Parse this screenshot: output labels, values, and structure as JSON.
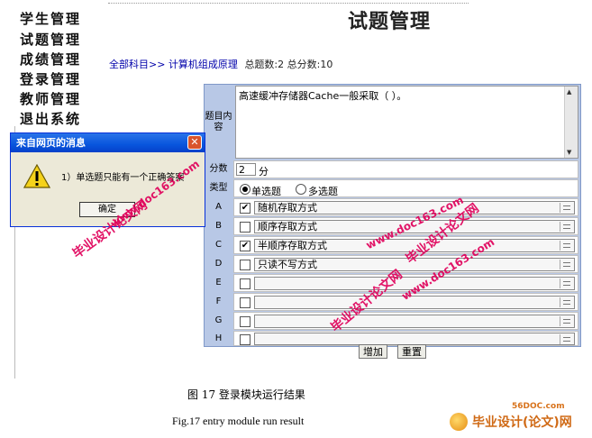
{
  "nav": {
    "items": [
      "学生管理",
      "试题管理",
      "成绩管理",
      "登录管理",
      "教师管理",
      "退出系统"
    ]
  },
  "page_title": "试题管理",
  "breadcrumb": {
    "root": "全部科目",
    "separator": ">>",
    "subject": "计算机组成原理",
    "info": "总题数:2 总分数:10"
  },
  "form": {
    "content_label": "题目内容",
    "content_value": "高速缓冲存储器Cache一般采取（ ）。",
    "score_label": "分数",
    "score_value": "2",
    "score_unit": "分",
    "type_label": "类型",
    "type_single": "单选题",
    "type_multi": "多选题",
    "type_selected": "single",
    "options": [
      {
        "key": "A",
        "text": "随机存取方式",
        "checked": true
      },
      {
        "key": "B",
        "text": "顺序存取方式",
        "checked": false
      },
      {
        "key": "C",
        "text": "半顺序存取方式",
        "checked": true
      },
      {
        "key": "D",
        "text": "只读不写方式",
        "checked": false
      },
      {
        "key": "E",
        "text": "",
        "checked": false
      },
      {
        "key": "F",
        "text": "",
        "checked": false
      },
      {
        "key": "G",
        "text": "",
        "checked": false
      },
      {
        "key": "H",
        "text": "",
        "checked": false
      }
    ],
    "add_button": "增加",
    "reset_button": "重置"
  },
  "dialog": {
    "title": "来自网页的消息",
    "close": "✕",
    "message": "1）单选题只能有一个正确答案",
    "ok_button": "确定"
  },
  "watermarks": [
    "毕业设计论文网",
    "www.doc163.com"
  ],
  "caption": {
    "cn": "图 17    登录模块运行结果",
    "en": "Fig.17     entry module run result"
  },
  "logo": {
    "small": "56DOC.com",
    "text": "毕业设计(论文)网"
  },
  "colors": {
    "form_bg": "#b8c8e6",
    "dialog_title": "#0855dd",
    "watermark": "#e0005a",
    "link": "#0000aa"
  }
}
